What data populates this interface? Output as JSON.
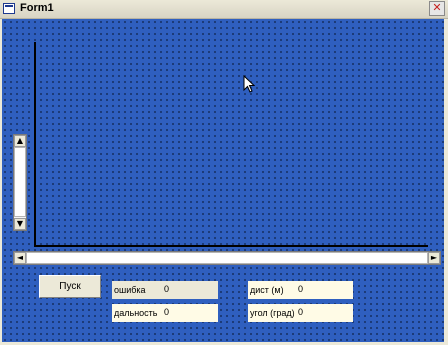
{
  "window": {
    "title": "Form1",
    "close_glyph": "✕"
  },
  "scrollbars": {
    "up": "▲",
    "down": "▼",
    "left": "◄",
    "right": "►"
  },
  "buttons": {
    "start_label": "Пуск"
  },
  "fields": {
    "error": {
      "label": "ошибка",
      "value": "0"
    },
    "range": {
      "label": "дальность",
      "value": "0"
    },
    "distance": {
      "label": "дист (м)",
      "value": "0"
    },
    "angle": {
      "label": "угол (град)",
      "value": "0"
    }
  },
  "icons": [
    "form-icon",
    "close-icon",
    "scroll-up-icon",
    "scroll-down-icon",
    "scroll-left-icon",
    "scroll-right-icon",
    "mouse-cursor-icon"
  ],
  "colors": {
    "canvas": "#2f5fbf",
    "window": "#ece9d8",
    "field_cream": "#fffbe6"
  }
}
